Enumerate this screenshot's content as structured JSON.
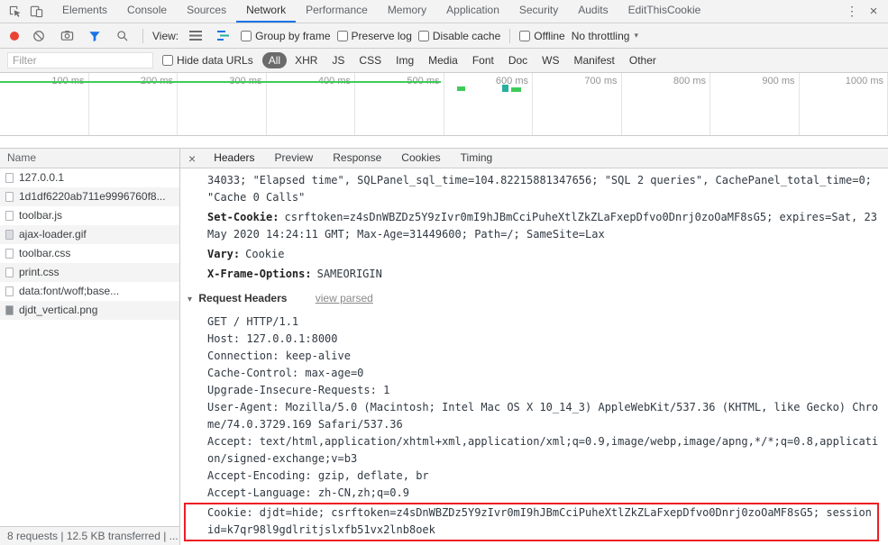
{
  "colors": {
    "accent_blue": "#1a73e8",
    "record_red": "#ea4335",
    "overview_green": "#3fcb59",
    "highlight_red": "#ee1d24",
    "pill_bg": "#6b6b6b"
  },
  "icons": {
    "more": "⋮",
    "close": "×",
    "caret": "▾",
    "triangle": "▾"
  },
  "devtools": {
    "tabs": [
      "Elements",
      "Console",
      "Sources",
      "Network",
      "Performance",
      "Memory",
      "Application",
      "Security",
      "Audits",
      "EditThisCookie"
    ],
    "active_tab": "Network"
  },
  "toolbar": {
    "view_label": "View:",
    "group_by_frame": "Group by frame",
    "preserve_log": "Preserve log",
    "disable_cache": "Disable cache",
    "offline": "Offline",
    "throttling_value": "No throttling"
  },
  "filter": {
    "placeholder": "Filter",
    "value": "",
    "hide_data_urls": "Hide data URLs",
    "types": [
      "All",
      "XHR",
      "JS",
      "CSS",
      "Img",
      "Media",
      "Font",
      "Doc",
      "WS",
      "Manifest",
      "Other"
    ],
    "selected": "All"
  },
  "overview": {
    "labels": [
      "100 ms",
      "200 ms",
      "300 ms",
      "400 ms",
      "500 ms",
      "600 ms",
      "700 ms",
      "800 ms",
      "900 ms",
      "1000 ms"
    ]
  },
  "requests": {
    "header": "Name",
    "rows": [
      {
        "name": "127.0.0.1",
        "icon": "document"
      },
      {
        "name": "1d1df6220ab711e9996760f8...",
        "icon": "document"
      },
      {
        "name": "toolbar.js",
        "icon": "script"
      },
      {
        "name": "ajax-loader.gif",
        "icon": "image"
      },
      {
        "name": "toolbar.css",
        "icon": "stylesheet"
      },
      {
        "name": "print.css",
        "icon": "stylesheet"
      },
      {
        "name": "data:font/woff;base...",
        "icon": "font"
      },
      {
        "name": "djdt_vertical.png",
        "icon": "image-dark"
      }
    ]
  },
  "details": {
    "close_label": "×",
    "tabs": [
      "Headers",
      "Preview",
      "Response",
      "Cookies",
      "Timing"
    ],
    "active_tab": "Headers",
    "response_fragment": "34033; \"Elapsed time\", SQLPanel_sql_time=104.82215881347656; \"SQL 2 queries\", CachePanel_total_time=0; \"Cache 0 Calls\"",
    "response_headers": [
      {
        "name": "Set-Cookie:",
        "value": "csrftoken=z4sDnWBZDz5Y9zIvr0mI9hJBmCciPuheXtlZkZLaFxepDfvo0Dnrj0zoOaMF8sG5; expires=Sat, 23 May 2020 14:24:11 GMT; Max-Age=31449600; Path=/; SameSite=Lax"
      },
      {
        "name": "Vary:",
        "value": "Cookie"
      },
      {
        "name": "X-Frame-Options:",
        "value": "SAMEORIGIN"
      }
    ],
    "request_headers_title": "Request Headers",
    "view_parsed_label": "view parsed",
    "raw_request": "GET / HTTP/1.1\nHost: 127.0.0.1:8000\nConnection: keep-alive\nCache-Control: max-age=0\nUpgrade-Insecure-Requests: 1\nUser-Agent: Mozilla/5.0 (Macintosh; Intel Mac OS X 10_14_3) AppleWebKit/537.36 (KHTML, like Gecko) Chrome/74.0.3729.169 Safari/537.36\nAccept: text/html,application/xhtml+xml,application/xml;q=0.9,image/webp,image/apng,*/*;q=0.8,application/signed-exchange;v=b3\nAccept-Encoding: gzip, deflate, br\nAccept-Language: zh-CN,zh;q=0.9",
    "cookie_line": "Cookie: djdt=hide; csrftoken=z4sDnWBZDz5Y9zIvr0mI9hJBmCciPuheXtlZkZLaFxepDfvo0Dnrj0zoOaMF8sG5; sessionid=k7qr98l9gdlritjslxfb51vx2lnb8oek"
  },
  "status_bar": {
    "text": "8 requests | 12.5 KB transferred | ..."
  }
}
